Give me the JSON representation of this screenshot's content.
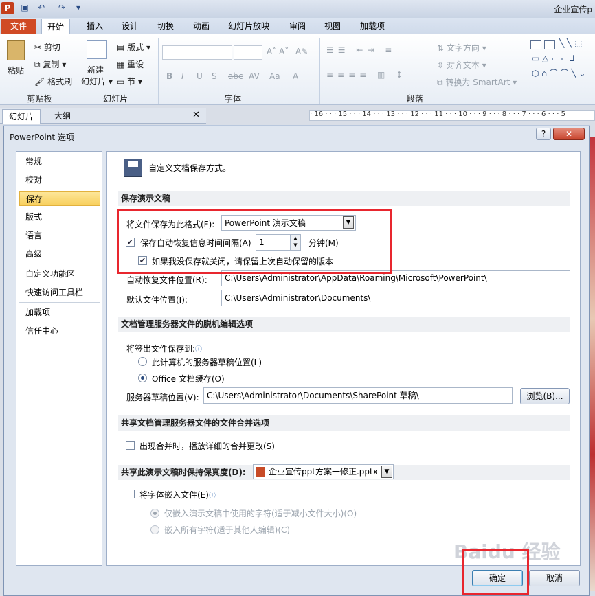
{
  "app": {
    "logo_letter": "P",
    "window_title": "企业宣传p"
  },
  "ribbon": {
    "tabs": [
      "文件",
      "开始",
      "插入",
      "设计",
      "切换",
      "动画",
      "幻灯片放映",
      "审阅",
      "视图",
      "加载项"
    ],
    "clipboard": {
      "paste": "粘贴",
      "cut": "剪切",
      "copy": "复制",
      "format_painter": "格式刷",
      "group": "剪贴板"
    },
    "slides": {
      "new_slide": "新建",
      "new_slide2": "幻灯片",
      "layout": "版式",
      "reset": "重设",
      "section": "节",
      "group": "幻灯片"
    },
    "font": {
      "group": "字体",
      "buttons": [
        "B",
        "I",
        "U",
        "S",
        "abc",
        "AV",
        "Aa",
        "A"
      ]
    },
    "paragraph": {
      "group": "段落",
      "text_direction": "文字方向",
      "align_text": "对齐文本",
      "smartart": "转换为 SmartArt"
    }
  },
  "panel": {
    "tab_slides": "幻灯片",
    "tab_outline": "大纲",
    "close": "✕"
  },
  "ruler": {
    "ticks": "· 16 · · · 15 · · · 14 · · · 13 · · · 12 · · · 11 · · · 10 · · · 9 · · · 8 · · · 7 · · · 6 · · · 5"
  },
  "dialog": {
    "title": "PowerPoint 选项",
    "help": "?",
    "close": "✕",
    "nav": [
      "常规",
      "校对",
      "保存",
      "版式",
      "语言",
      "高级",
      "自定义功能区",
      "快速访问工具栏",
      "加载项",
      "信任中心"
    ],
    "selected_nav": "保存",
    "header_text": "自定义文档保存方式。",
    "section_save": "保存演示文稿",
    "save_format_label": "将文件保存为此格式(F):",
    "save_format_value": "PowerPoint 演示文稿",
    "autorecover_label": "保存自动恢复信息时间间隔(A)",
    "autorecover_minutes": "1",
    "minutes_label": "分钟(M)",
    "keep_last_label": "如果我没保存就关闭，请保留上次自动保留的版本",
    "autorecover_location_label": "自动恢复文件位置(R):",
    "autorecover_location_value": "C:\\Users\\Administrator\\AppData\\Roaming\\Microsoft\\PowerPoint\\",
    "default_location_label": "默认文件位置(I):",
    "default_location_value": "C:\\Users\\Administrator\\Documents\\",
    "section_offline": "文档管理服务器文件的脱机编辑选项",
    "checkout_label": "将签出文件保存到:",
    "radio_server_drafts": "此计算机的服务器草稿位置(L)",
    "radio_office_cache": "Office 文档缓存(O)",
    "server_drafts_label": "服务器草稿位置(V):",
    "server_drafts_value": "C:\\Users\\Administrator\\Documents\\SharePoint 草稿\\",
    "browse": "浏览(B)...",
    "section_merge": "共享文档管理服务器文件的文件合并选项",
    "merge_label": "出现合并时，播放详细的合并更改(S)",
    "section_fidelity": "共享此演示文稿时保持保真度(D):",
    "fidelity_file": "企业宣传ppt方案一修正.pptx",
    "embed_fonts_label": "将字体嵌入文件(E)",
    "embed_used_label": "仅嵌入演示文稿中使用的字符(适于减小文件大小)(O)",
    "embed_all_label": "嵌入所有字符(适于其他人编辑)(C)",
    "ok": "确定",
    "cancel": "取消",
    "watermark": "Baidu 经验"
  },
  "state": {
    "autorecover_checked": true,
    "keep_last_checked": true,
    "merge_checked": false,
    "embed_checked": false,
    "office_cache_selected": true
  },
  "colors": {
    "highlight": "#e8262e",
    "file_tab": "#d04a25",
    "nav_selected": "#f8cf5c"
  }
}
